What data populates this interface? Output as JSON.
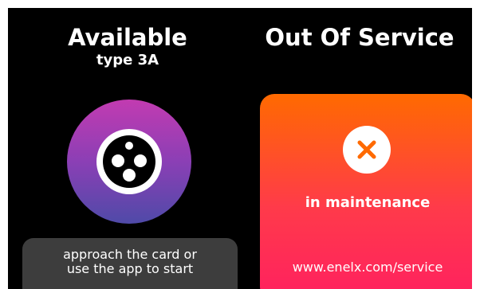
{
  "left_panel": {
    "status_title": "Available",
    "connector_type": "type 3A",
    "connector_icon": "type-3a-socket-icon",
    "ring_colors": [
      "#c23bb1",
      "#4f4aa8"
    ],
    "hint_line_1": "approach the card or",
    "hint_line_2": "use the app to start"
  },
  "right_panel": {
    "status_title": "Out Of Service",
    "status_icon": "close-x-icon",
    "status_icon_color": "#ff6a00",
    "status_label": "in maintenance",
    "service_link": "www.enelx.com/service",
    "card_colors": [
      "#ff6a00",
      "#ff2060"
    ]
  }
}
